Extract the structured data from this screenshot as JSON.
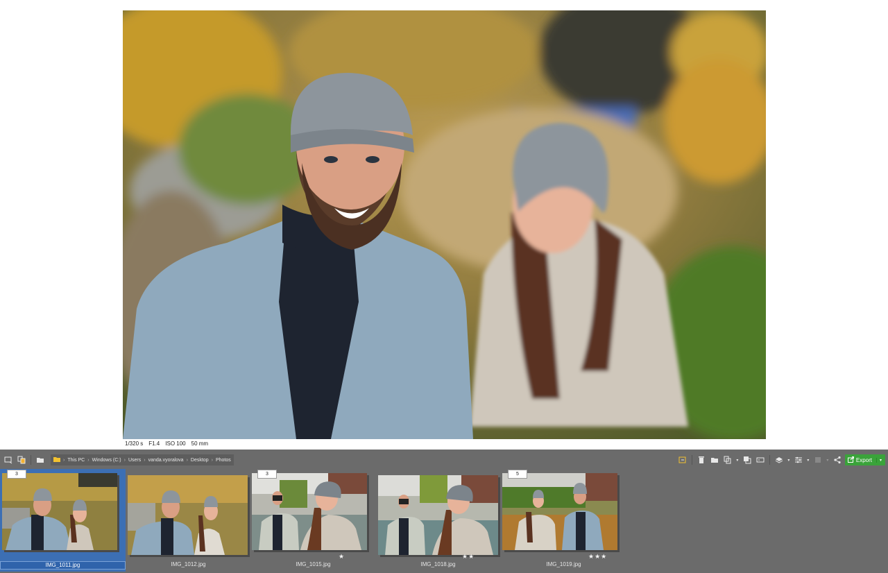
{
  "viewer": {
    "exif": {
      "shutter": "1/320 s",
      "aperture": "F1.4",
      "iso": "ISO 100",
      "focal": "50 mm"
    }
  },
  "breadcrumb": [
    "This PC",
    "Windows (C:)",
    "Users",
    "vanda.vyoralova",
    "Desktop",
    "Photos"
  ],
  "toolbar": {
    "export_label": "Export"
  },
  "thumbnails": [
    {
      "filename": "IMG_1011.jpg",
      "badge": "3",
      "stars": "",
      "selected": true
    },
    {
      "filename": "IMG_1012.jpg",
      "badge": "",
      "stars": "",
      "selected": false
    },
    {
      "filename": "IMG_1015.jpg",
      "badge": "3",
      "stars": "★",
      "selected": false
    },
    {
      "filename": "IMG_1018.jpg",
      "badge": "",
      "stars": "★★",
      "selected": false
    },
    {
      "filename": "IMG_1019.jpg",
      "badge": "5",
      "stars": "★★★",
      "selected": false
    }
  ],
  "colors": {
    "panel": "#6b6b6b",
    "selection": "#3c6fb4",
    "export": "#3aa33a"
  }
}
